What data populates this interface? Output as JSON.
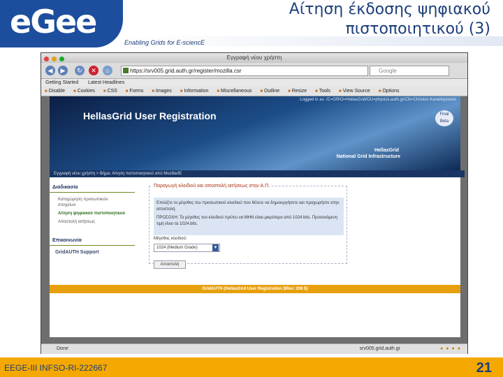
{
  "slide": {
    "logo": "eGee",
    "tagline": "Enabling Grids for E-sciencE",
    "title_line1": "Αίτηση έκδοσης ψηφιακού",
    "title_line2": "πιστοποιητικού (3)",
    "footer_left": "EEGE-III INFSO-RI-222667",
    "page_number": "21"
  },
  "browser": {
    "window_title": "Εγγραφή νέου χρήστη",
    "url": "https://srv005.grid.auth.gr/register/mozilla.csr",
    "search_placeholder": "Google",
    "bookmarks": [
      "Getting Started",
      "Latest Headlines"
    ],
    "devtools": [
      "Disable",
      "Cookies",
      "CSS",
      "Forms",
      "Images",
      "Information",
      "Miscellaneous",
      "Outline",
      "Resize",
      "Tools",
      "View Source",
      "Options"
    ],
    "status_text": "Done",
    "status_host": "srv005.grid.auth.gr"
  },
  "webpage": {
    "login_info": "Logged in as: /C=GR/O=HellasGrid/OU=physics.auth.gr/CN=Christos Kanellopoulos",
    "banner_title": "HellasGrid User Registration",
    "banner_sub1": "HellasGrid",
    "banner_sub2": "National Grid Infrastructure",
    "badge": "Final Beta",
    "breadcrumb": "Εγγραφή νέου χρήστη > Βήμα: Αίτηση πιστοποιητικού από Mozilla/IE",
    "sidebar": {
      "heading": "Διαδικασία",
      "items": [
        {
          "label": "Καταχώρηση προσωπικών στοιχείων",
          "active": false
        },
        {
          "label": "Αίτηση ψηφιακού πιστοποιητικού",
          "active": true
        },
        {
          "label": "Αποστολή αιτήσεως",
          "active": false
        }
      ],
      "heading2": "Επικοινωνία",
      "support": "GridAUTH Support"
    },
    "form": {
      "legend": "Παραγωγή κλειδιού και αποστολή αιτήσεως στην Α.Π.",
      "info1": "Επιλέξτε το μέγεθος του προσωπικού κλειδιού που θέλετε να δημιουργήσετε και προχωρήστε στην αποστολή.",
      "info2": "ΠΡΟΣΟΧΗ: Το μέγεθος του κλειδιού πρέπει να ΜΗΝ είναι μικρότερο από 1024 bits. Προτεινόμενη τιμή είναι τα 1024 bits.",
      "field_label": "Μέγεθος κλειδιού:",
      "select_value": "1024 (Medium Grade)",
      "submit_label": "Αποστολή"
    },
    "footer": "GridAUTH (HellasGrid User Registration $Rev: 206 $)"
  }
}
